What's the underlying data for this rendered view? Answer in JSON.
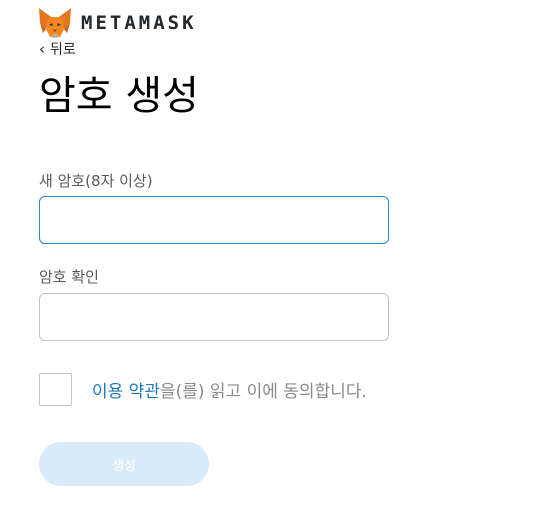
{
  "brand": {
    "name": "METAMASK",
    "logo_icon": "fox-icon",
    "colors": {
      "fox_orange": "#e2761b",
      "fox_light": "#f6851b",
      "fox_dark": "#763d16"
    }
  },
  "nav": {
    "back_label": "뒤로",
    "back_icon": "chevron-left-icon"
  },
  "page": {
    "title": "암호 생성"
  },
  "form": {
    "new_password_label": "새 암호(8자 이상)",
    "new_password_value": "",
    "confirm_password_label": "암호 확인",
    "confirm_password_value": ""
  },
  "terms": {
    "checked": false,
    "link_text": "이용 약관",
    "suffix_text": "을(를) 읽고 이에 동의합니다.",
    "link_color": "#1f7ac2"
  },
  "actions": {
    "create_label": "생성",
    "create_enabled": false
  },
  "colors": {
    "focus_border": "#2f88c9",
    "disabled_button": "#d9ebf8"
  }
}
